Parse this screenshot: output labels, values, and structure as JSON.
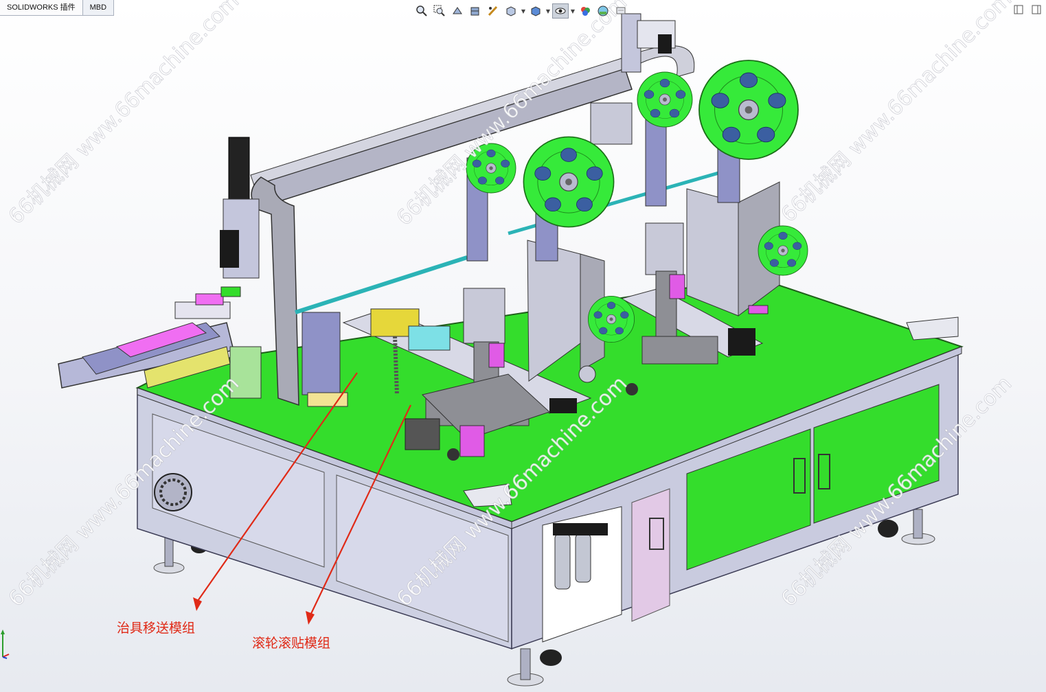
{
  "tabs": [
    {
      "label": "SOLIDWORKS 插件",
      "active": true
    },
    {
      "label": "MBD",
      "active": false
    }
  ],
  "heads_up_toolbar": [
    {
      "icon": "zoom-to-fit-icon"
    },
    {
      "icon": "zoom-to-area-icon"
    },
    {
      "icon": "previous-view-icon"
    },
    {
      "icon": "section-view-icon"
    },
    {
      "icon": "dynamic-annotation-icon"
    },
    {
      "icon": "view-orientation-icon",
      "dropdown": true
    },
    {
      "icon": "display-style-icon",
      "dropdown": true
    },
    {
      "icon": "hide-show-items-icon",
      "dropdown": true,
      "pressed": true
    },
    {
      "icon": "edit-appearance-icon"
    },
    {
      "icon": "apply-scene-icon"
    },
    {
      "icon": "view-settings-icon"
    }
  ],
  "window_controls": [
    {
      "icon": "tile-horizontal-icon"
    },
    {
      "icon": "tile-vertical-icon"
    }
  ],
  "watermark": "66机械网 www.66machine.com",
  "annotations": [
    {
      "label": "治具移送模组"
    },
    {
      "label": "滚轮滚贴模组"
    }
  ],
  "colors": {
    "table_top": "#34dd2c",
    "reel": "#36ea3a",
    "frame": "#c4c6dc",
    "callout": "#e02a17",
    "carriage": "#8f92c7",
    "magenta_parts": "#e05be6"
  }
}
